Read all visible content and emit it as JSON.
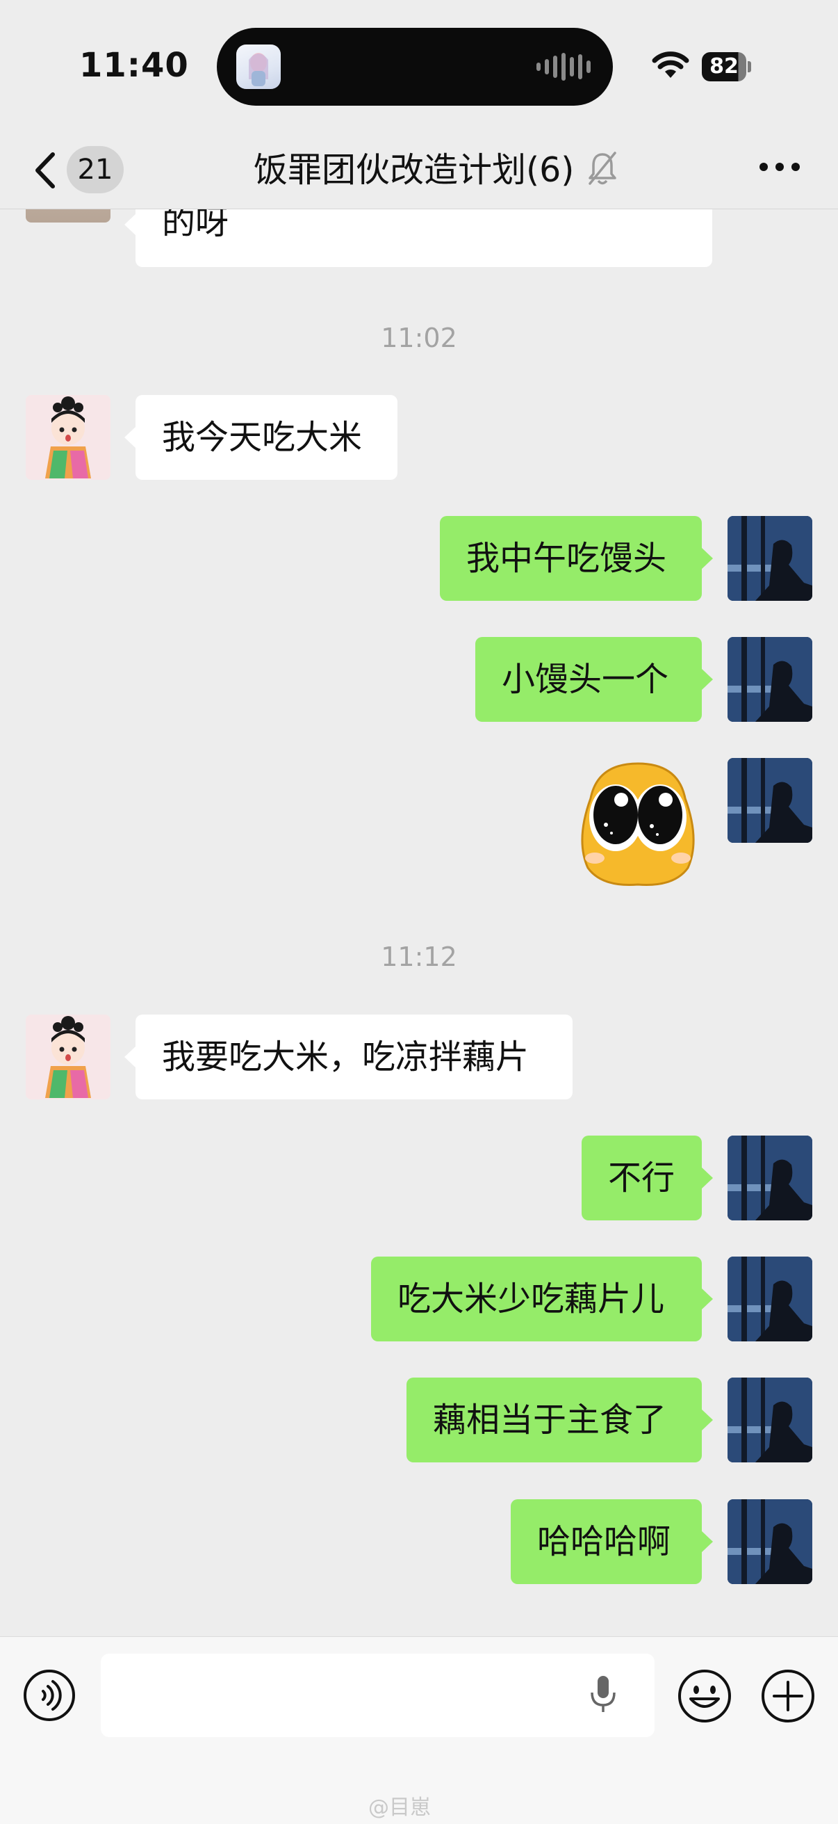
{
  "status_bar": {
    "time": "11:40",
    "battery": "82",
    "icons": [
      "island-app-icon",
      "audio-wave-icon",
      "wifi-icon",
      "battery-icon"
    ]
  },
  "header": {
    "unread_count": "21",
    "title": "饭罪团伙改造计划(6)",
    "icons": [
      "back-chevron-icon",
      "mute-bell-icon",
      "more-dots-icon"
    ]
  },
  "chat": {
    "partial_message": "的呀",
    "timestamps": [
      "11:02",
      "11:12"
    ],
    "messages": [
      {
        "side": "in",
        "text": "我今天吃大米"
      },
      {
        "side": "out",
        "text": "我中午吃馒头"
      },
      {
        "side": "out",
        "text": "小馒头一个"
      },
      {
        "side": "out",
        "sticker": "big-eyes-sticker"
      },
      {
        "side": "in",
        "text": "我要吃大米，吃凉拌藕片"
      },
      {
        "side": "out",
        "text": "不行"
      },
      {
        "side": "out",
        "text": "吃大米少吃藕片儿"
      },
      {
        "side": "out",
        "text": "藕相当于主食了"
      },
      {
        "side": "out",
        "text": "哈哈哈啊"
      }
    ]
  },
  "input_bar": {
    "value": "",
    "icons": [
      "voice-mode-icon",
      "microphone-icon",
      "emoji-icon",
      "plus-icon"
    ]
  },
  "watermark": "@目崽",
  "colors": {
    "background": "#ededed",
    "outgoing_bubble": "#95ec69",
    "incoming_bubble": "#ffffff",
    "timestamp": "#a3a3a3"
  }
}
